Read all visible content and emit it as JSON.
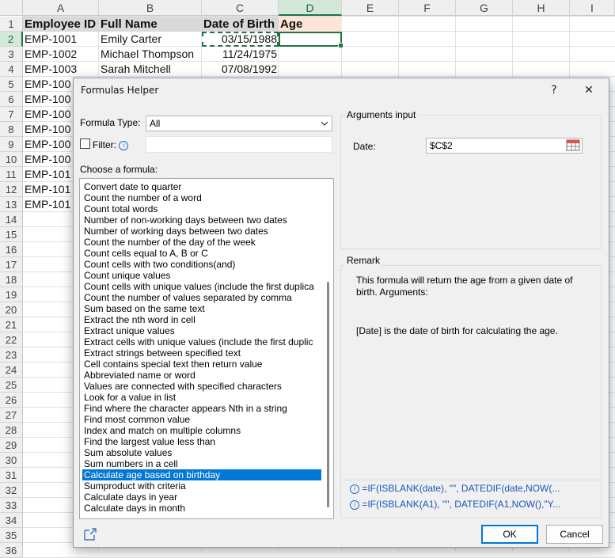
{
  "sheet": {
    "columns": [
      "A",
      "B",
      "C",
      "D",
      "E",
      "F",
      "G",
      "H",
      "I"
    ],
    "rows": [
      "1",
      "2",
      "3",
      "4",
      "5",
      "6",
      "7",
      "8",
      "9",
      "10",
      "11",
      "12",
      "13",
      "14",
      "15",
      "16",
      "17",
      "18",
      "19",
      "20",
      "21",
      "22",
      "23",
      "24",
      "25",
      "26",
      "27",
      "28",
      "29",
      "30",
      "31",
      "32",
      "33",
      "34",
      "35",
      "36"
    ],
    "headers": {
      "employee_id": "Employee ID",
      "full_name": "Full Name",
      "dob": "Date of Birth",
      "age": "Age"
    },
    "data": [
      {
        "id": "EMP-1001",
        "name": "Emily Carter",
        "dob": "03/15/1988"
      },
      {
        "id": "EMP-1002",
        "name": "Michael Thompson",
        "dob": "11/24/1975"
      },
      {
        "id": "EMP-1003",
        "name": "Sarah Mitchell",
        "dob": "07/08/1992"
      },
      {
        "id": "EMP-100"
      },
      {
        "id": "EMP-100"
      },
      {
        "id": "EMP-100"
      },
      {
        "id": "EMP-100"
      },
      {
        "id": "EMP-100"
      },
      {
        "id": "EMP-100"
      },
      {
        "id": "EMP-101"
      },
      {
        "id": "EMP-101"
      },
      {
        "id": "EMP-101"
      }
    ],
    "active_cell": "D2"
  },
  "dialog": {
    "title": "Formulas Helper",
    "help_label": "?",
    "close_label": "✕",
    "formula_type_label": "Formula Type:",
    "formula_type_value": "All",
    "filter_label": "Filter:",
    "filter_value": "",
    "choose_label": "Choose a formula:",
    "formulas": [
      "Convert date to quarter",
      "Count the number of a word",
      "Count total words",
      "Number of non-working days between two dates",
      "Number of working days between two dates",
      "Count the number of the day of the week",
      "Count cells equal to A, B or C",
      "Count cells with two conditions(and)",
      "Count unique values",
      "Count cells with unique values (include the first duplica",
      "Count the number of values separated by comma",
      "Sum based on the same text",
      "Extract the nth word in cell",
      "Extract unique values",
      "Extract cells with unique values (include the first duplic",
      "Extract strings between specified text",
      "Cell contains special text then return value",
      "Abbreviated name or word",
      "Values are connected with specified characters",
      "Look for a value in list",
      "Find where the character appears Nth in a string",
      "Find most common value",
      "Index and match on multiple columns",
      "Find the largest value less than",
      "Sum absolute values",
      "Sum numbers in a cell",
      "Calculate age based on birthday",
      "Sumproduct with criteria",
      "Calculate days in year",
      "Calculate days in month"
    ],
    "selected_formula_index": 26,
    "arguments_title": "Arguments input",
    "date_label": "Date:",
    "date_value": "$C$2",
    "remark_title": "Remark",
    "remark_line1": "This formula will return the age from a given date of birth. Arguments:",
    "remark_line2": "[Date] is the date of birth for calculating the age.",
    "formula_example_1": "=IF(ISBLANK(date), \"\", DATEDIF(date,NOW(...",
    "formula_example_2": "=IF(ISBLANK(A1), \"\", DATEDIF(A1,NOW(),\"Y...",
    "ok_label": "OK",
    "cancel_label": "Cancel",
    "accent_color": "#0078d7"
  }
}
